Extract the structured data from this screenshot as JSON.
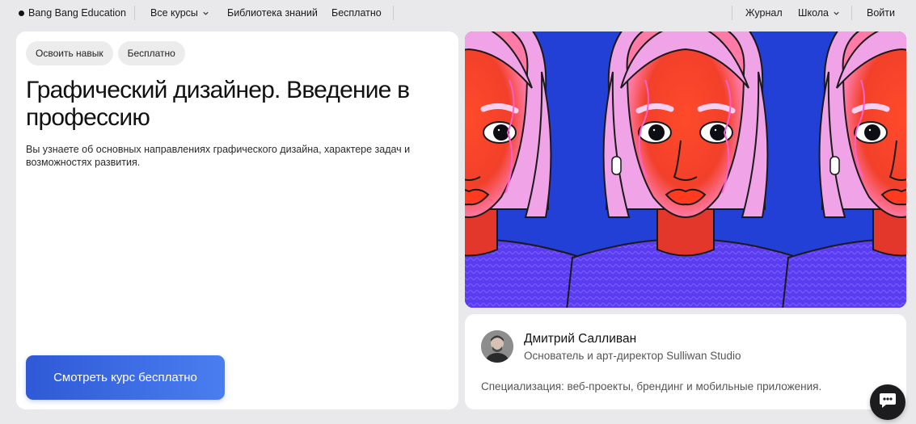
{
  "nav": {
    "brand": "Bang Bang Education",
    "all_courses": "Все курсы",
    "library": "Библиотека знаний",
    "free": "Бесплатно",
    "journal": "Журнал",
    "school": "Школа",
    "login": "Войти"
  },
  "course": {
    "tags": [
      "Освоить навык",
      "Бесплатно"
    ],
    "title": "Графический дизайнер. Введение в профессию",
    "description": "Вы узнаете об основных направлениях графического дизайна, характере задач и возможностях развития.",
    "cta_label": "Смотреть курс бесплатно"
  },
  "author": {
    "name": "Дмитрий Салливан",
    "role": "Основатель и арт-директор Sulliwan Studio",
    "specialization": "Специализация: веб-проекты, брендинг и мобильные приложения."
  },
  "colors": {
    "accent": "#3b6ae6",
    "hero_background": "#2340d6",
    "page_background": "#e9e9ec"
  },
  "icons": {
    "chevron": "chevron-down-icon",
    "chat": "chat-icon",
    "brand_dot": "dot-icon"
  }
}
